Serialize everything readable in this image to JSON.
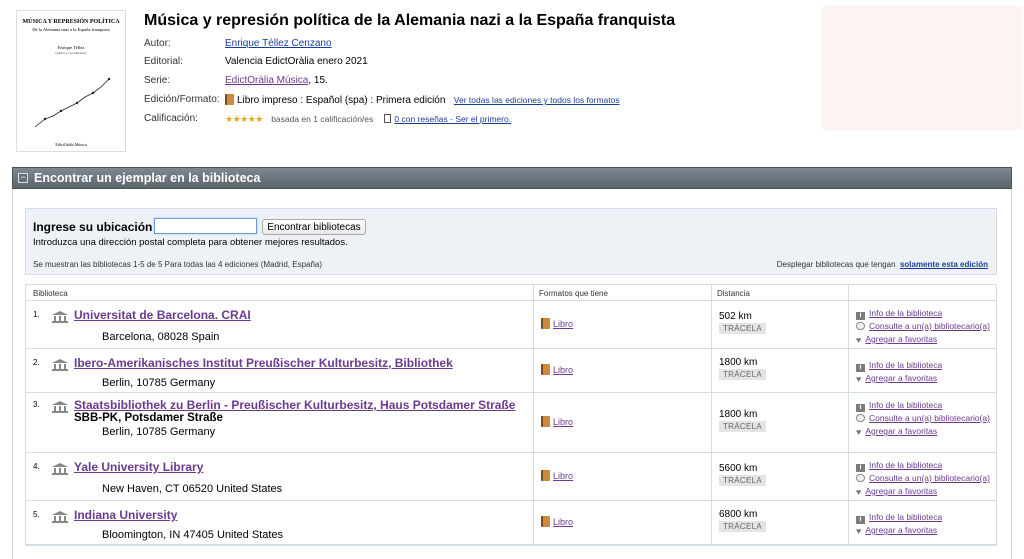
{
  "cover": {
    "title": "MÚSICA Y REPRESIÓN POLÍTICA",
    "subtitle": "De la Alemania nazi a la España franquista",
    "author": "Enrique Téllez",
    "author_role": "(editor y coordinador)",
    "publisher": "EdictOràlia Música"
  },
  "record": {
    "title": "Música y represión política de la Alemania nazi a la España franquista",
    "author_label": "Autor:",
    "author": "Enrique Téllez Cenzano",
    "publisher_label": "Editorial:",
    "publisher": "Valencia EdictOràlia enero 2021",
    "series_label": "Serie:",
    "series": "EdictOràlia Música",
    "series_num": ", 15.",
    "format_label": "Edición/Formato:",
    "format": "Libro impreso : Español (spa) : Primera edición",
    "all_editions": "Ver todas las ediciones y todos los formatos",
    "rating_label": "Calificación:",
    "stars": "★★★★★",
    "rating_text": "basada en 1 calificación/es",
    "reviews": "0 con reseñas - Ser el primero."
  },
  "panel": {
    "toggle": "−",
    "title": "Encontrar un ejemplar en la biblioteca",
    "location_label": "Ingrese su ubicación",
    "location_value": "",
    "find_button": "Encontrar bibliotecas",
    "hint": "Introduzca una dirección postal completa para obtener mejores resultados.",
    "showing": "Se muestran las bibliotecas 1-5 de 5 Para todas las 4 ediciones (Madrid, España)",
    "display_prefix": "Desplegar bibliotecas que tengan",
    "display_link": "solamente esta edición"
  },
  "table": {
    "headers": [
      "Biblioteca",
      "Formatos que tiene",
      "Distancia"
    ],
    "action_labels": {
      "info": "Info de la biblioteca",
      "ask": "Consulte a un(a) bibliotecario(a)",
      "fav": "Agregar a favoritas"
    },
    "rows": [
      {
        "num": "1.",
        "name": "Universitat de Barcelona. CRAI",
        "extra": "",
        "address": "Barcelona, 08028 Spain",
        "format": "Libro",
        "distance": "502 km",
        "trace": "TRÁCELA"
      },
      {
        "num": "2.",
        "name": "Ibero-Amerikanisches Institut Preußischer Kulturbesitz, Bibliothek",
        "extra": "",
        "address": "Berlin, 10785 Germany",
        "format": "Libro",
        "distance": "1800 km",
        "trace": "TRÁCELA"
      },
      {
        "num": "3.",
        "name": "Staatsbibliothek zu Berlin - Preußischer Kulturbesitz, Haus Potsdamer Straße",
        "extra": "SBB-PK, Potsdamer Straße",
        "address": "Berlin, 10785 Germany",
        "format": "Libro",
        "distance": "1800 km",
        "trace": "TRÁCELA"
      },
      {
        "num": "4.",
        "name": "Yale University Library",
        "extra": "",
        "address": "New Haven, CT 06520 United States",
        "format": "Libro",
        "distance": "5600 km",
        "trace": "TRÁCELA"
      },
      {
        "num": "5.",
        "name": "Indiana University",
        "extra": "",
        "address": "Bloomington, IN 47405 United States",
        "format": "Libro",
        "distance": "6800 km",
        "trace": "TRÁCELA"
      }
    ]
  }
}
